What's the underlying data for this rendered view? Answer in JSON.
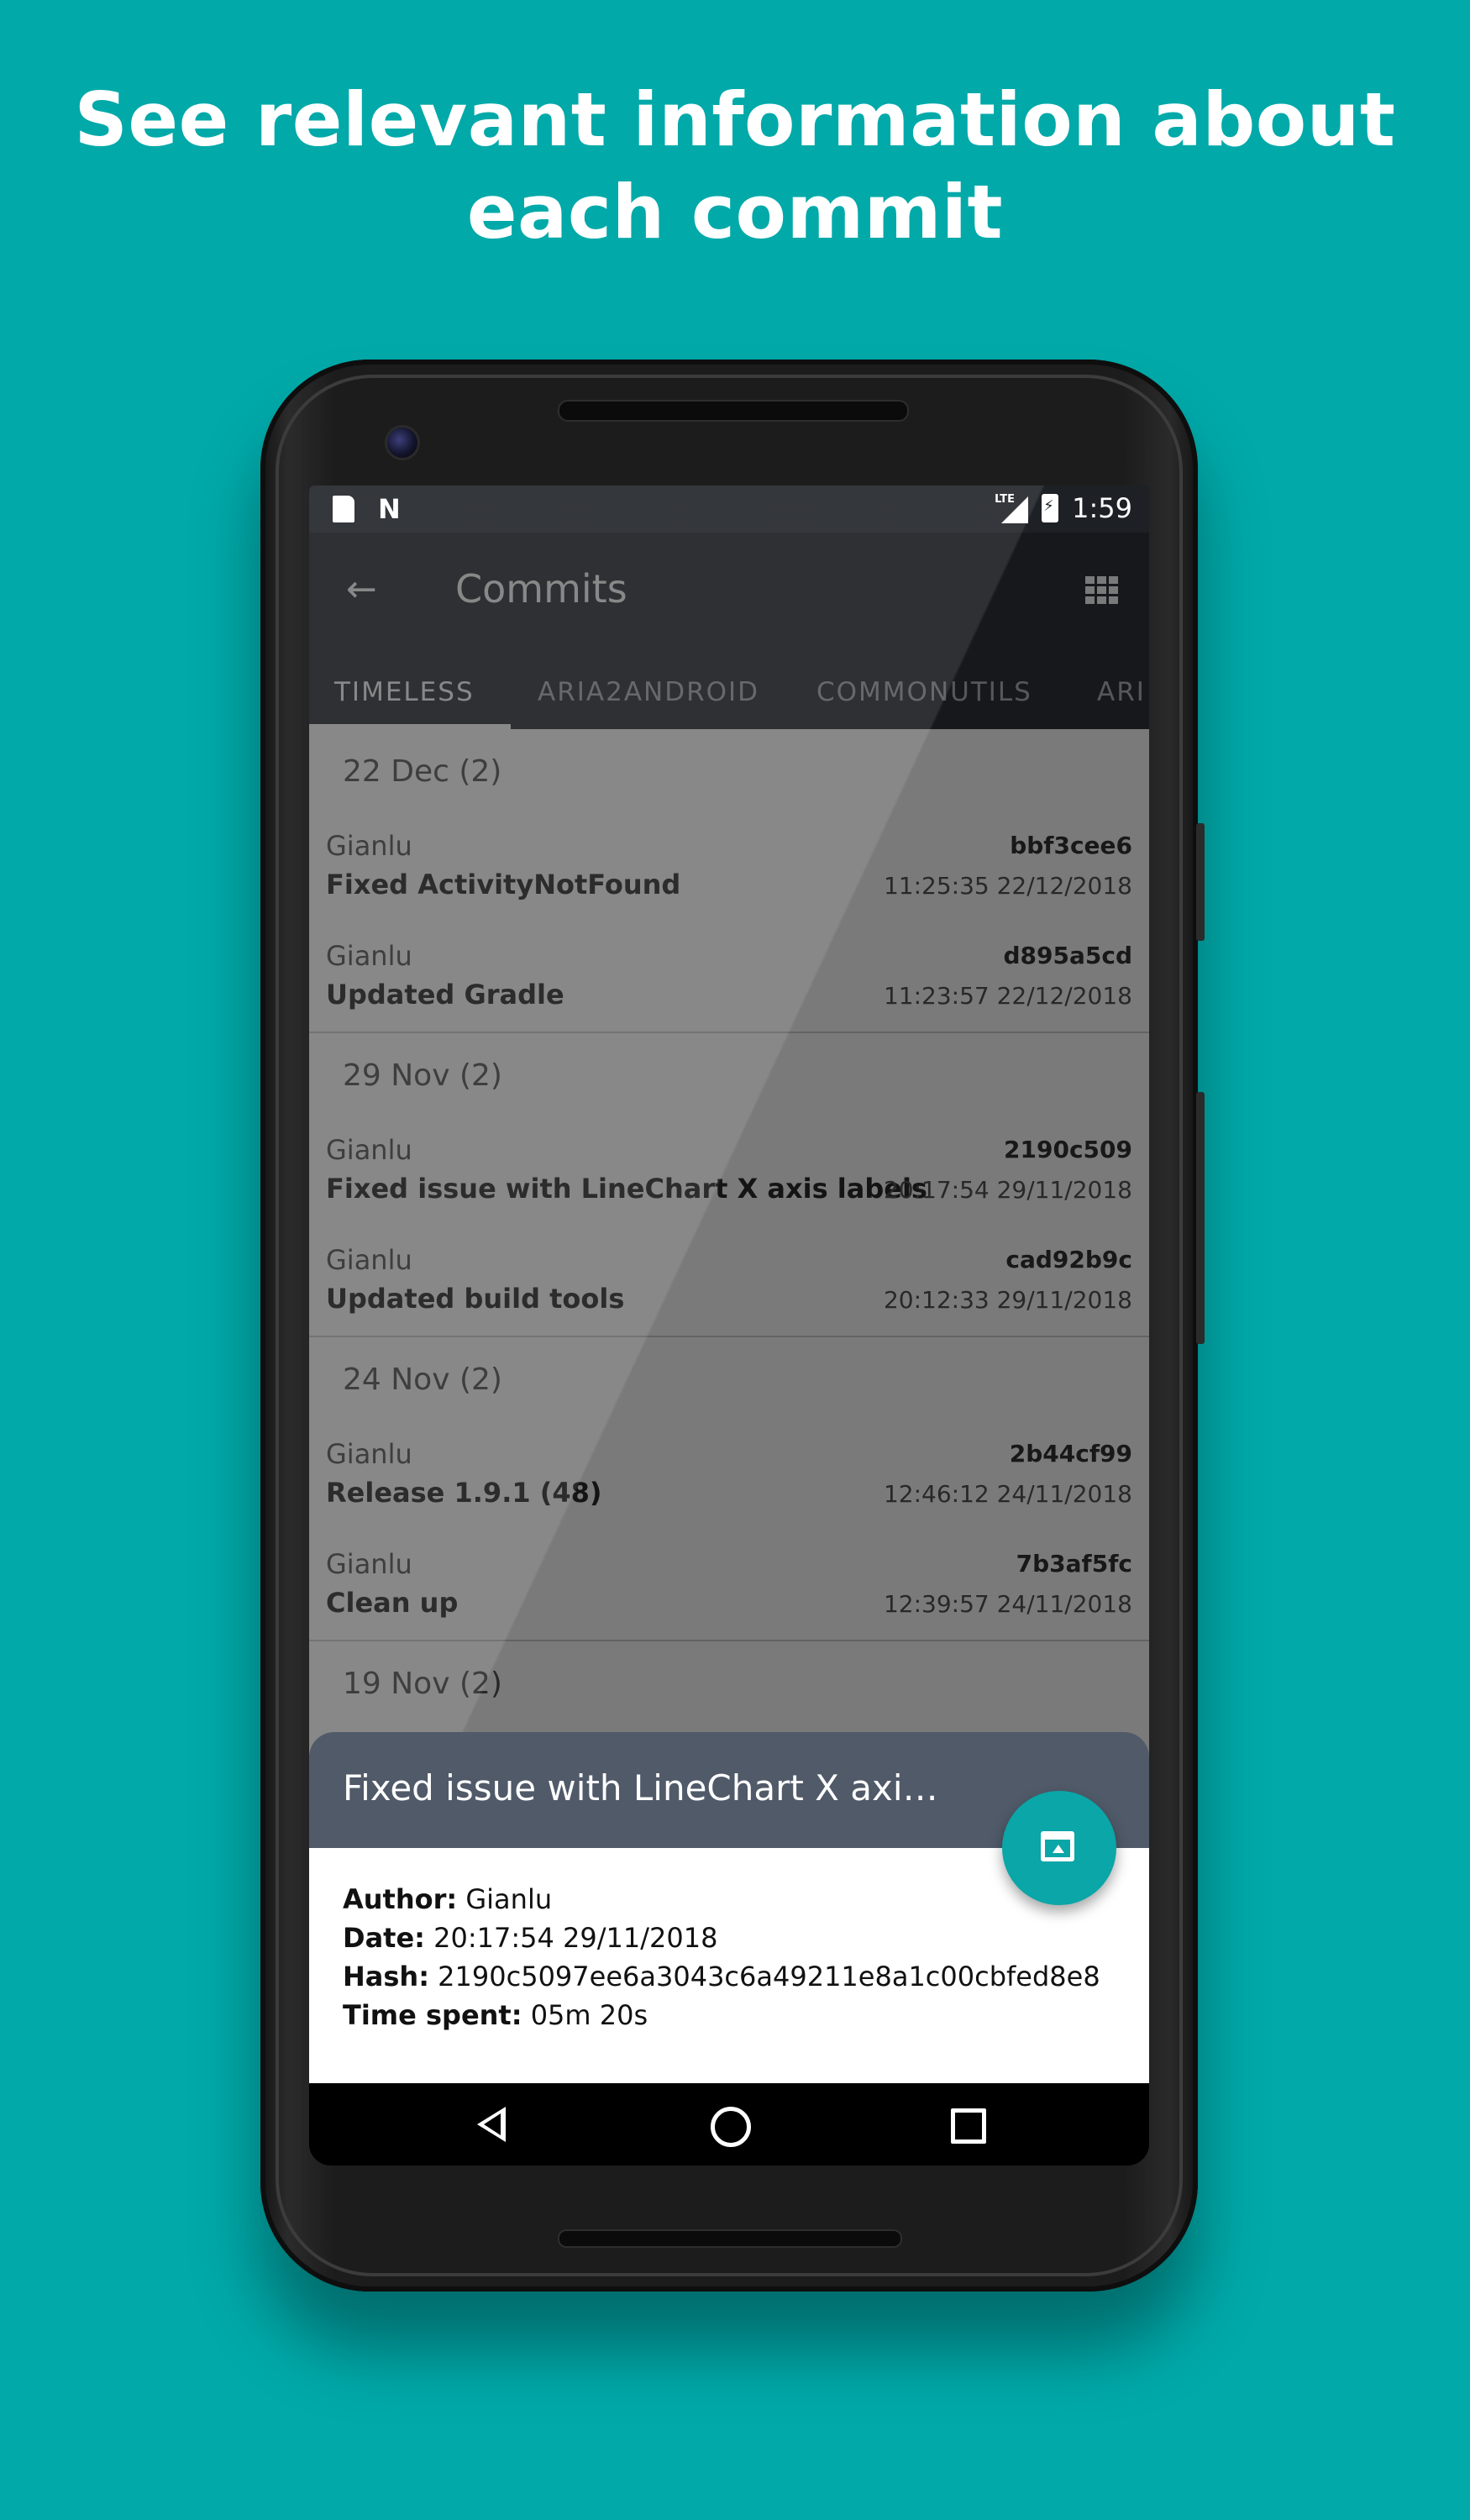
{
  "headline": {
    "line1": "See relevant information about",
    "line2": "each commit"
  },
  "statusbar": {
    "network": "LTE",
    "time": "1:59"
  },
  "appbar": {
    "title": "Commits"
  },
  "tabs": [
    {
      "label": "TIMELESS",
      "active": true
    },
    {
      "label": "ARIA2ANDROID",
      "active": false
    },
    {
      "label": "COMMONUTILS",
      "active": false
    },
    {
      "label": "ARI",
      "active": false
    }
  ],
  "groups": [
    {
      "header": "22 Dec (2)",
      "commits": [
        {
          "author": "Gianlu",
          "message": "Fixed ActivityNotFound",
          "hash": "bbf3cee6",
          "time": "11:25:35 22/12/2018"
        },
        {
          "author": "Gianlu",
          "message": "Updated Gradle",
          "hash": "d895a5cd",
          "time": "11:23:57 22/12/2018"
        }
      ]
    },
    {
      "header": "29 Nov (2)",
      "commits": [
        {
          "author": "Gianlu",
          "message": "Fixed issue with LineChart X axis labels",
          "hash": "2190c509",
          "time": "20:17:54 29/11/2018"
        },
        {
          "author": "Gianlu",
          "message": "Updated build tools",
          "hash": "cad92b9c",
          "time": "20:12:33 29/11/2018"
        }
      ]
    },
    {
      "header": "24 Nov (2)",
      "commits": [
        {
          "author": "Gianlu",
          "message": "Release 1.9.1 (48)",
          "hash": "2b44cf99",
          "time": "12:46:12 24/11/2018"
        },
        {
          "author": "Gianlu",
          "message": "Clean up",
          "hash": "7b3af5fc",
          "time": "12:39:57 24/11/2018"
        }
      ]
    },
    {
      "header": "19 Nov (2)",
      "commits": []
    }
  ],
  "sheet": {
    "title": "Fixed issue with LineChart X axi…",
    "author_label": "Author:",
    "author_value": "Gianlu",
    "date_label": "Date:",
    "date_value": "20:17:54 29/11/2018",
    "hash_label": "Hash:",
    "hash_value": "2190c5097ee6a3043c6a49211e8a1c00cbfed8e8",
    "time_label": "Time spent:",
    "time_value": "05m 20s"
  },
  "icons": {
    "back": "arrow-left-icon",
    "view_mode": "grid-icon",
    "fab": "open-in-browser-icon"
  },
  "colors": {
    "background": "#01a9a9",
    "appbar": "#2e333b",
    "sheet_header": "#505a69",
    "fab": "#0aa6a8"
  }
}
